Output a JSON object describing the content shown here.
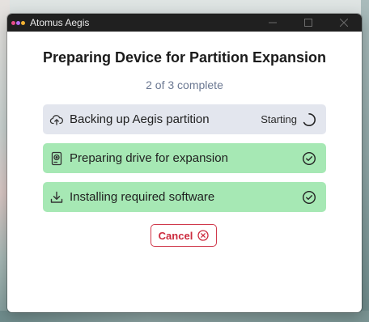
{
  "window": {
    "title": "Atomus Aegis",
    "logo_colors": [
      "#e84d8a",
      "#b56cf0",
      "#f2b233"
    ]
  },
  "heading": "Preparing Device for Partition Expansion",
  "progress_text": "2 of 3 complete",
  "tasks": [
    {
      "label": "Backing up Aegis partition",
      "status": "Starting",
      "state": "in-progress",
      "icon": "cloud-upload-icon"
    },
    {
      "label": "Preparing drive for expansion",
      "state": "complete",
      "icon": "drive-icon"
    },
    {
      "label": "Installing required software",
      "state": "complete",
      "icon": "download-icon"
    }
  ],
  "cancel_label": "Cancel",
  "colors": {
    "pending_bg": "#e3e6ee",
    "complete_bg": "#a6e8b4",
    "cancel": "#cc2b3e",
    "titlebar": "#202020"
  }
}
